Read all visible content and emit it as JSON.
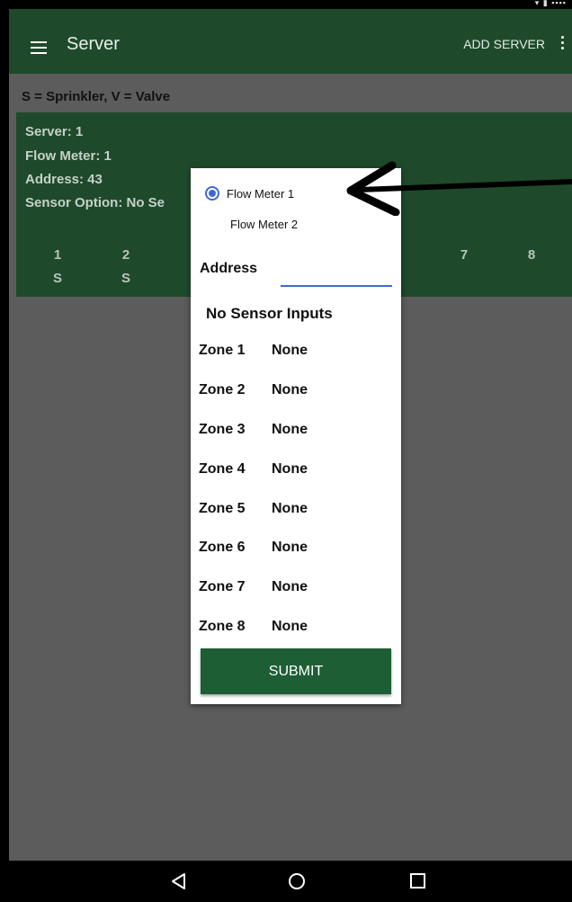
{
  "appbar": {
    "title": "Server",
    "add_server_label": "ADD SERVER"
  },
  "legend": {
    "text": "S = Sprinkler, V = Valve"
  },
  "card": {
    "server": "Server: 1",
    "flow_meter": "Flow Meter: 1",
    "address": "Address: 43",
    "sensor_option": "Sensor Option: No Se",
    "zones": [
      {
        "num": "1",
        "type": "S"
      },
      {
        "num": "2",
        "type": "S"
      },
      {
        "num": "7",
        "type": ""
      },
      {
        "num": "8",
        "type": ""
      }
    ]
  },
  "dialog": {
    "radio_options": [
      "Flow Meter 1",
      "Flow Meter 2"
    ],
    "selected_index": 0,
    "address_label": "Address",
    "address_value": "",
    "sensor_inputs_label": "No Sensor Inputs",
    "zones": [
      {
        "label": "Zone 1",
        "value": "None"
      },
      {
        "label": "Zone 2",
        "value": "None"
      },
      {
        "label": "Zone 3",
        "value": "None"
      },
      {
        "label": "Zone 4",
        "value": "None"
      },
      {
        "label": "Zone 5",
        "value": "None"
      },
      {
        "label": "Zone 6",
        "value": "None"
      },
      {
        "label": "Zone 7",
        "value": "None"
      },
      {
        "label": "Zone 8",
        "value": "None"
      }
    ],
    "submit_label": "SUBMIT"
  },
  "colors": {
    "appbar": "#1e4a2b",
    "accent": "#3f6bd1",
    "submit": "#1e5e35",
    "scrim": "#5c5c5c"
  }
}
